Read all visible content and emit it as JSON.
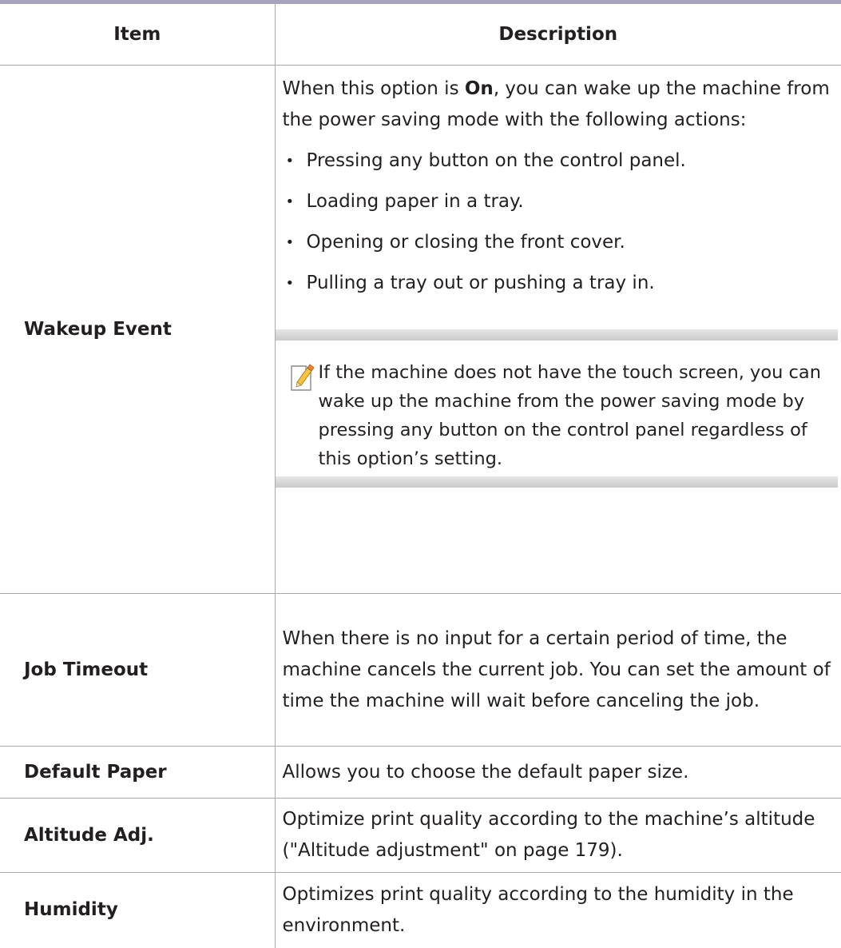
{
  "header": {
    "item": "Item",
    "description": "Description"
  },
  "wakeup": {
    "item": "Wakeup Event",
    "intro_1": "When this option is ",
    "intro_bold": "On",
    "intro_2": ", you can wake up the machine from the power saving mode with the following actions:",
    "bullets": [
      "Pressing any button on the control panel.",
      "Loading paper in a tray.",
      "Opening or closing the front cover.",
      "Pulling a tray out or pushing a tray in."
    ],
    "note_icon": "note-pencil-icon",
    "note": "If the machine does not have the touch screen, you can wake up the machine from the power saving mode by pressing any button on the control panel regardless of this option’s setting."
  },
  "rows": [
    {
      "item": "Job Timeout",
      "desc": "When there is no input for a certain period of time, the machine cancels the current job. You can set the amount of time the machine will wait before canceling the job."
    },
    {
      "item": "Default Paper",
      "desc": "Allows you to choose the default paper size."
    },
    {
      "item": "Altitude Adj.",
      "desc": "Optimize print quality according to the machine’s altitude (\"Altitude adjustment\" on page 179)."
    },
    {
      "item": "Humidity",
      "desc": "Optimizes print quality according to the humidity in the environment."
    }
  ]
}
